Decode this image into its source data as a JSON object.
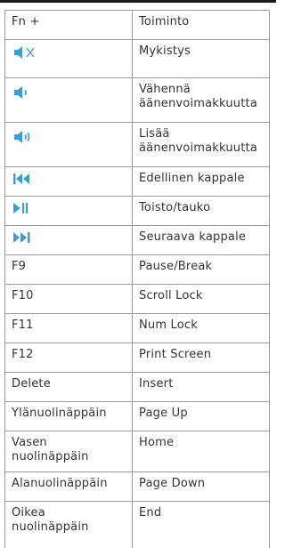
{
  "table": {
    "header": {
      "key": "Fn +",
      "function": "Toiminto"
    },
    "rows": [
      {
        "icon": "mute-icon",
        "function": "Mykistys"
      },
      {
        "icon": "volume-down-icon",
        "function": "Vähennä äänenvoimakkuutta"
      },
      {
        "icon": "volume-up-icon",
        "function": "Lisää äänenvoimakkuutta"
      },
      {
        "icon": "previous-track-icon",
        "function": "Edellinen kappale"
      },
      {
        "icon": "play-pause-icon",
        "function": "Toisto/tauko"
      },
      {
        "icon": "next-track-icon",
        "function": "Seuraava kappale"
      },
      {
        "key": "F9",
        "function": "Pause/Break"
      },
      {
        "key": "F10",
        "function": "Scroll Lock"
      },
      {
        "key": "F11",
        "function": "Num Lock"
      },
      {
        "key": "F12",
        "function": "Print Screen"
      },
      {
        "key": "Delete",
        "function": "Insert"
      },
      {
        "key": "Ylänuolinäppäin",
        "function": "Page Up"
      },
      {
        "key": "Vasen nuolinäppäin",
        "function": "Home"
      },
      {
        "key": "Alanuolinäppäin",
        "function": "Page Down"
      },
      {
        "key": "Oikea nuolinäppäin",
        "function": "End"
      }
    ]
  },
  "colors": {
    "icon": "#3a9fd4",
    "border": "#9a9a9a",
    "text": "#333333",
    "top_rule": "#1a1a1a"
  }
}
